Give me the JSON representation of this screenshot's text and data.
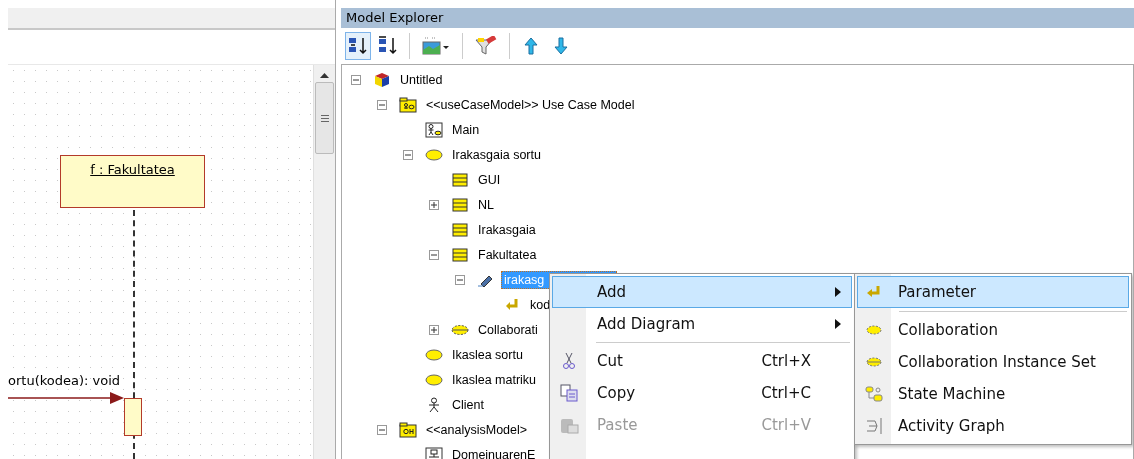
{
  "diagram": {
    "lifeline": {
      "label": "f : Fakultatea"
    },
    "message": {
      "label": "ortu(kodea): void"
    }
  },
  "model_explorer": {
    "title": "Model Explorer",
    "toolbar": [
      {
        "kind": "sort-numeric",
        "selected": true
      },
      {
        "kind": "sort-alpha",
        "selected": false
      },
      {
        "kind": "separator"
      },
      {
        "kind": "view-dropdown",
        "selected": false
      },
      {
        "kind": "separator"
      },
      {
        "kind": "filter",
        "selected": false
      },
      {
        "kind": "separator"
      },
      {
        "kind": "move-up",
        "selected": false
      },
      {
        "kind": "move-down",
        "selected": false
      }
    ],
    "tree": [
      {
        "label": "Untitled",
        "kind": "project",
        "expanded": true,
        "selected": false,
        "children": [
          {
            "label": "<<useCaseModel>> Use Case Model",
            "kind": "model",
            "expanded": true,
            "selected": false,
            "children": [
              {
                "label": "Main",
                "kind": "diagram",
                "selected": false
              },
              {
                "label": "Irakasgaia sortu",
                "kind": "usecase",
                "expanded": true,
                "selected": false,
                "children": [
                  {
                    "label": "GUI",
                    "kind": "class",
                    "selected": false
                  },
                  {
                    "label": "NL",
                    "kind": "class",
                    "expanded": false,
                    "selected": false
                  },
                  {
                    "label": "Irakasgaia",
                    "kind": "class",
                    "selected": false
                  },
                  {
                    "label": "Fakultatea",
                    "kind": "class",
                    "expanded": true,
                    "selected": false,
                    "children": [
                      {
                        "label": "irakasg",
                        "kind": "operation",
                        "expanded": true,
                        "selected": true,
                        "children": [
                          {
                            "label": "kod",
                            "kind": "parameter",
                            "selected": false
                          }
                        ]
                      }
                    ]
                  },
                  {
                    "label": "Collaborati",
                    "kind": "collaboration",
                    "expanded": false,
                    "selected": false
                  }
                ]
              },
              {
                "label": "Ikaslea sortu",
                "kind": "usecase",
                "selected": false
              },
              {
                "label": "Ikaslea matriku",
                "kind": "usecase",
                "selected": false
              },
              {
                "label": "Client",
                "kind": "actor",
                "selected": false
              }
            ]
          },
          {
            "label": "<<analysisModel>",
            "kind": "analysis-model",
            "expanded": true,
            "selected": false,
            "children": [
              {
                "label": "DomeinuarenE",
                "kind": "class-diagram",
                "selected": false
              }
            ]
          }
        ]
      }
    ]
  },
  "context_menu": {
    "items": [
      {
        "kind": "submenu",
        "label": "Add",
        "selected": true,
        "disabled": false
      },
      {
        "kind": "submenu",
        "label": "Add Diagram",
        "selected": false,
        "disabled": false
      },
      {
        "kind": "separator"
      },
      {
        "kind": "cut",
        "label": "Cut",
        "shortcut": "Ctrl+X",
        "selected": false,
        "disabled": false
      },
      {
        "kind": "copy",
        "label": "Copy",
        "shortcut": "Ctrl+C",
        "selected": false,
        "disabled": false
      },
      {
        "kind": "paste",
        "label": "Paste",
        "shortcut": "Ctrl+V",
        "selected": false,
        "disabled": true
      }
    ]
  },
  "submenu": {
    "items": [
      {
        "kind": "parameter",
        "label": "Parameter",
        "selected": true
      },
      {
        "kind": "separator"
      },
      {
        "kind": "collaboration",
        "label": "Collaboration",
        "selected": false
      },
      {
        "kind": "collaboration-instance-set",
        "label": "Collaboration Instance Set",
        "selected": false
      },
      {
        "kind": "state-machine",
        "label": "State Machine",
        "selected": false
      },
      {
        "kind": "activity-graph",
        "label": "Activity Graph",
        "selected": false
      }
    ]
  }
}
